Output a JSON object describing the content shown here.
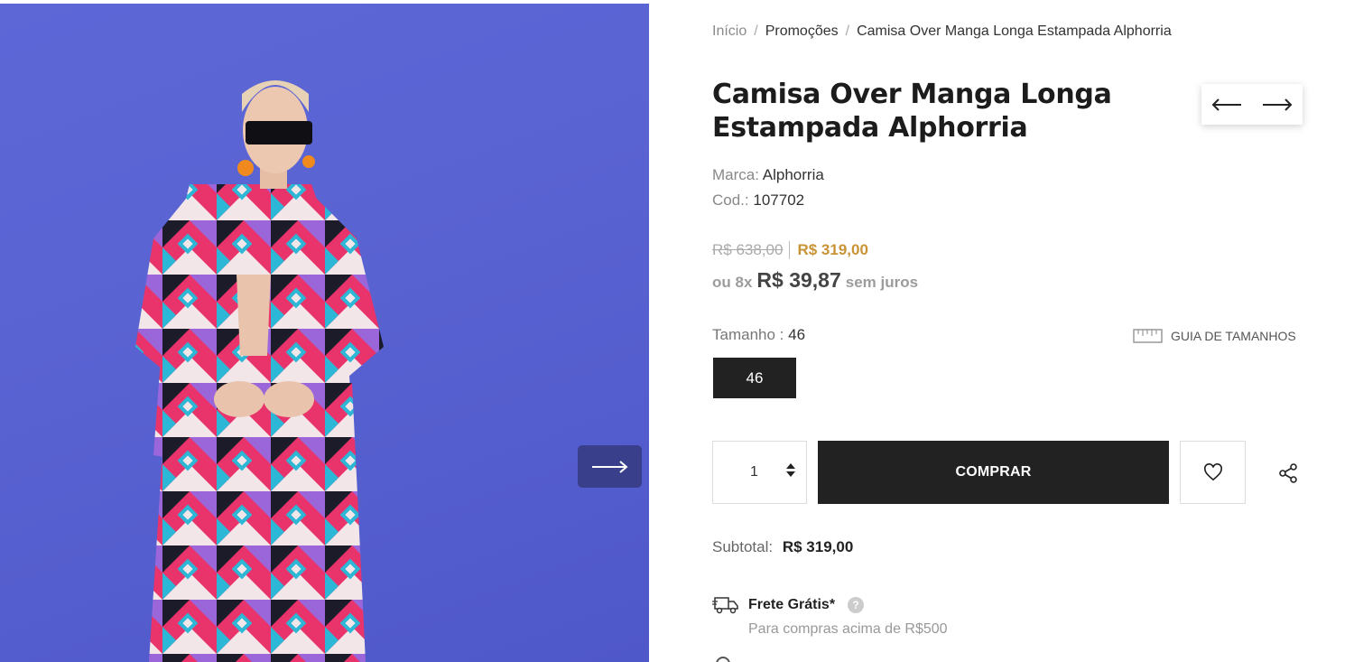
{
  "product_image": {
    "alt": "Modelo vestindo Camisa Over Manga Longa Estampada Alphorria",
    "background_color": "#5d67d6",
    "next_icon": "arrow-right-icon"
  },
  "breadcrumb": {
    "home": "Início",
    "separator": "/",
    "category": "Promoções",
    "current": "Camisa Over Manga Longa Estampada Alphorria"
  },
  "product": {
    "title": "Camisa Over Manga Longa Estampada Alphorria",
    "brand_label": "Marca:",
    "brand": "Alphorria",
    "code_label": "Cod.:",
    "code": "107702"
  },
  "pricing": {
    "old_price": "R$ 638,00",
    "price": "R$ 319,00",
    "installments_prefix": "ou 8x",
    "installment_value": "R$ 39,87",
    "installments_suffix": "sem juros",
    "price_color": "#c89334"
  },
  "size": {
    "label": "Tamanho :",
    "selected": "46",
    "guide_label": "GUIA DE TAMANHOS",
    "options": [
      "46"
    ]
  },
  "purchase": {
    "quantity": "1",
    "buy_label": "COMPRAR"
  },
  "subtotal": {
    "label": "Subtotal:",
    "value": "R$ 319,00"
  },
  "shipping": {
    "label": "Frete Grátis*",
    "help": "?",
    "note": "Para compras acima de R$500"
  }
}
